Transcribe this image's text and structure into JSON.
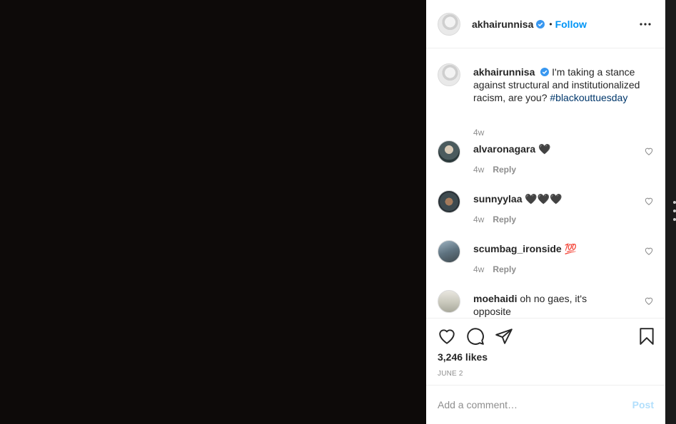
{
  "post": {
    "username": "akhairunnisa",
    "follow_label": "Follow",
    "separator": "•"
  },
  "caption": {
    "username": "akhairunnisa",
    "text": "I'm taking a stance against structural and institutionalized racism, are you? ",
    "hashtag": "#blackouttuesday",
    "time": "4w"
  },
  "comments": [
    {
      "username": "alvaronagara",
      "text": "🖤",
      "time": "4w",
      "reply_label": "Reply"
    },
    {
      "username": "sunnyylaa",
      "text": "🖤🖤🖤",
      "time": "4w",
      "reply_label": "Reply"
    },
    {
      "username": "scumbag_ironside",
      "text": "💯",
      "time": "4w",
      "reply_label": "Reply"
    },
    {
      "username": "moehaidi",
      "text": "oh no gaes, it's opposite",
      "time": "",
      "reply_label": ""
    }
  ],
  "stats": {
    "likes": "3,246 likes",
    "date": "JUNE 2"
  },
  "composer": {
    "placeholder": "Add a comment…",
    "post_label": "Post"
  },
  "colors": {
    "accent": "#0095f6",
    "post_disabled": "#b2dffc",
    "media_bg": "#0d0a09"
  }
}
